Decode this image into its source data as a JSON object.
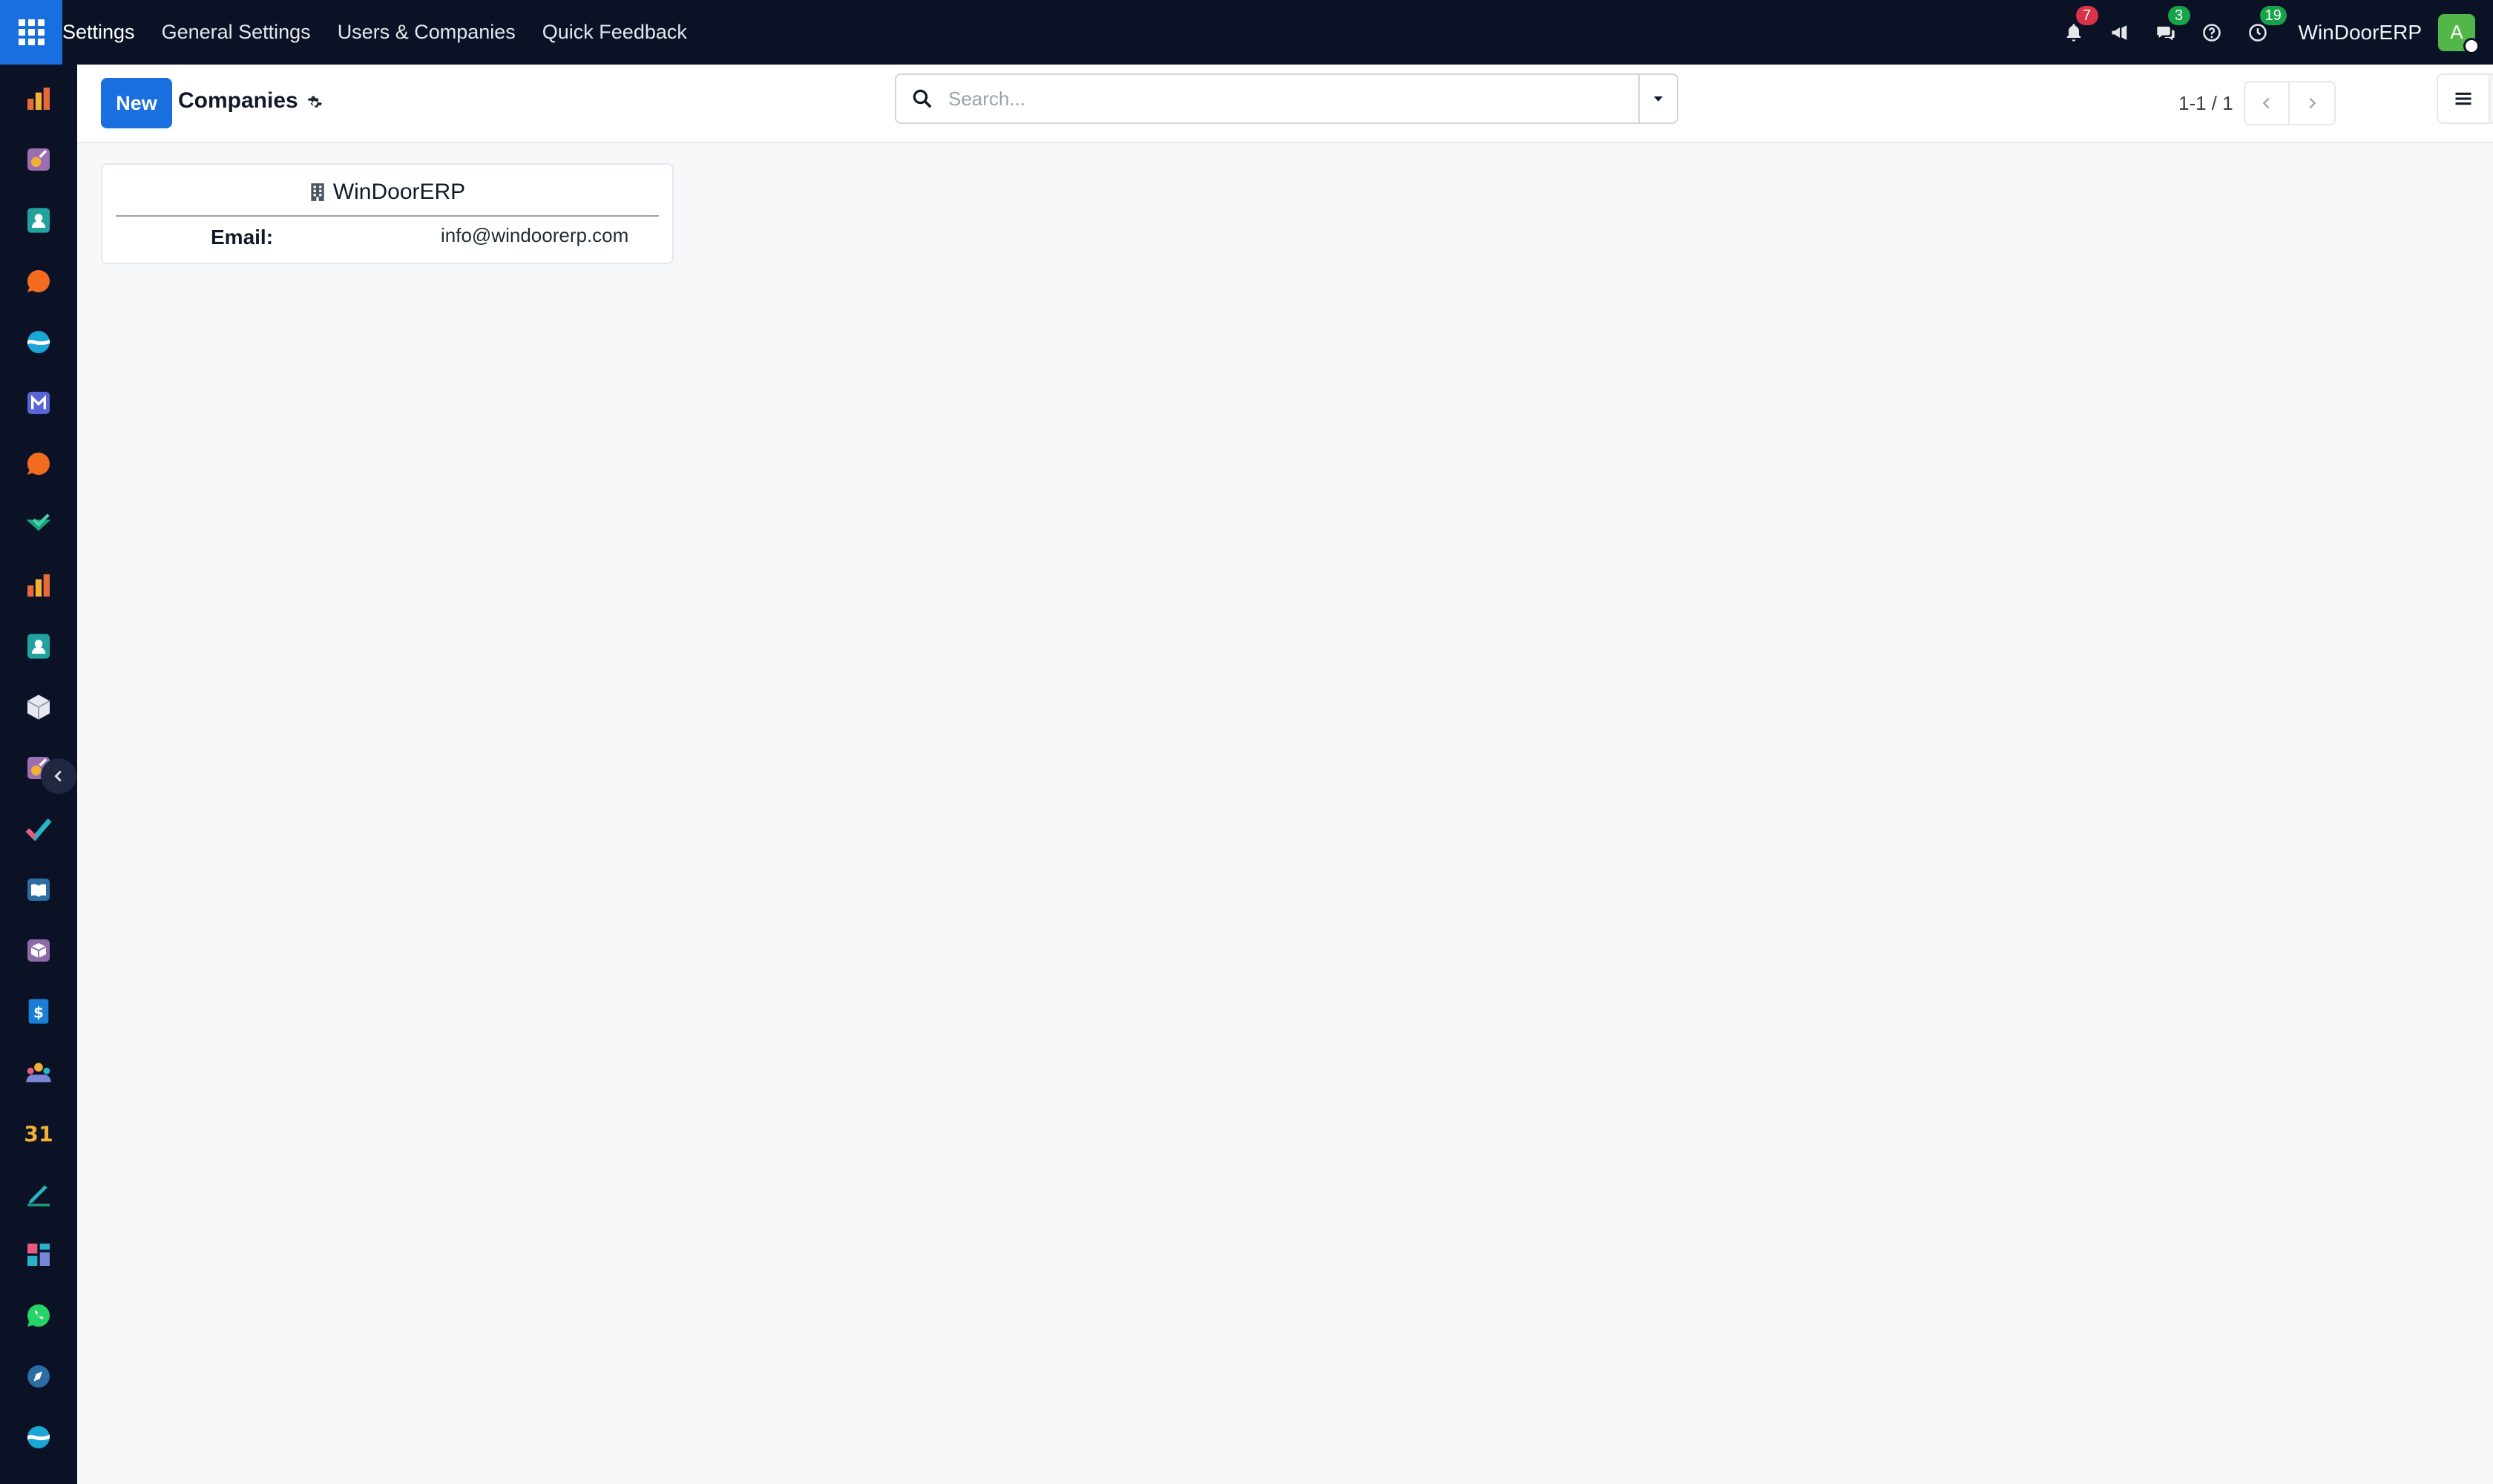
{
  "navbar": {
    "apps_menu_icon": "grid-icon",
    "brand": "Settings",
    "menu_items": [
      "General Settings",
      "Users & Companies",
      "Quick Feedback"
    ],
    "systray": {
      "notifications_count": "7",
      "messages_count": "3",
      "activities_count": "19",
      "company_name": "WinDoorERP",
      "avatar_initial": "A"
    }
  },
  "sidebar": {
    "apps": [
      "bar-chart-icon",
      "paint-palette-icon",
      "contacts-icon",
      "chat-bubble-icon",
      "wave-logo-icon",
      "mail-icon",
      "chat-bubble-icon",
      "checkmark-ribbon-icon",
      "bar-chart-icon",
      "contacts-icon",
      "cube-icon",
      "paint-palette-icon",
      "check-icon",
      "book-icon",
      "box-icon",
      "invoice-icon",
      "people-icon",
      "calendar-icon",
      "pen-icon",
      "dashboard-icon",
      "whatsapp-icon",
      "compass-icon",
      "wave-logo-icon"
    ],
    "collapse_icon": "chevron-left-icon"
  },
  "control_panel": {
    "new_button": "New",
    "title": "Companies",
    "search_placeholder": "Search...",
    "pager_value": "1-1 / 1"
  },
  "records": [
    {
      "name": "WinDoorERP",
      "email_label": "Email:",
      "email": "info@windoorerp.com"
    }
  ],
  "colors": {
    "navbar_bg": "#0c1226",
    "primary": "#1a6fe0",
    "badge_red": "#d9334a",
    "badge_green": "#16a34a",
    "avatar_bg": "#52b748"
  }
}
